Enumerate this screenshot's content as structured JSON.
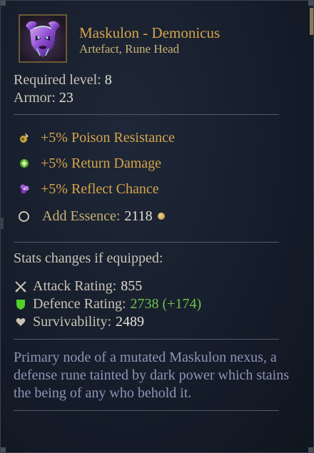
{
  "item": {
    "name": "Maskulon - Demonicus",
    "type": "Artefact, Rune Head",
    "icon": "demon-rune-head-icon"
  },
  "requirements": {
    "level_label": "Required level:",
    "level_value": "8",
    "armor_label": "Armor:",
    "armor_value": "23"
  },
  "modifiers": [
    {
      "icon": "poison-resistance-icon",
      "text": "+5% Poison Resistance"
    },
    {
      "icon": "return-damage-icon",
      "text": "+5% Return Damage"
    },
    {
      "icon": "reflect-chance-icon",
      "text": "+5% Reflect Chance"
    }
  ],
  "essence": {
    "label": "Add Essence:",
    "value": "2118",
    "icon": "gold-coin-icon"
  },
  "stats_changes": {
    "title": "Stats changes if equipped:",
    "attack_label": "Attack Rating:",
    "attack_value": "855",
    "defence_label": "Defence Rating:",
    "defence_value": "2738 (+174)",
    "survivability_label": "Survivability:",
    "survivability_value": "2489"
  },
  "description": "Primary node of a mutated Maskulon nexus, a defense rune tainted by dark power which stains the being of any who behold it.",
  "colors": {
    "item_name": "#d6a44a",
    "modifier": "#d6a44a",
    "positive_change": "#6fc24a",
    "description": "#8e95b6"
  }
}
